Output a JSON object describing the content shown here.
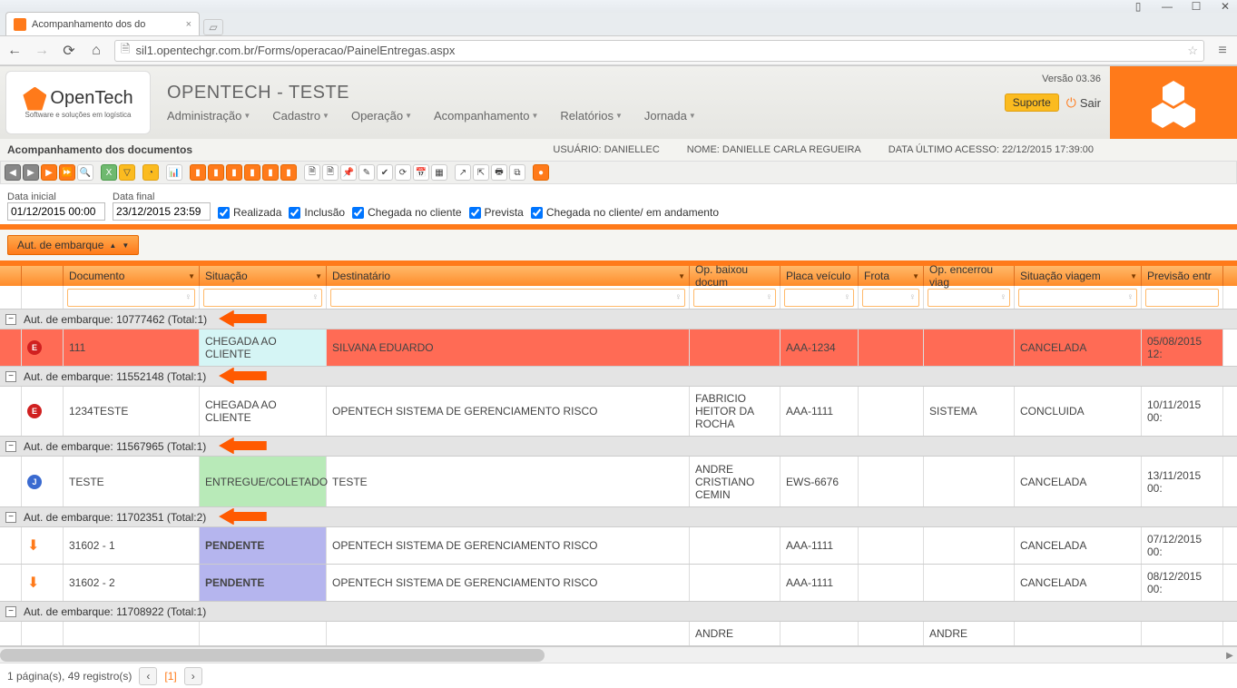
{
  "browser": {
    "tab_title": "Acompanhamento dos do",
    "url": "sil1.opentechgr.com.br/Forms/operacao/PainelEntregas.aspx"
  },
  "header": {
    "logo_text": "OpenTech",
    "logo_sub": "Software e soluções em logística",
    "brand_title": "OPENTECH - TESTE",
    "menu": [
      "Administração",
      "Cadastro",
      "Operação",
      "Acompanhamento",
      "Relatórios",
      "Jornada"
    ],
    "version": "Versão 03.36",
    "btn_suporte": "Suporte",
    "btn_sair": "Sair"
  },
  "page": {
    "title": "Acompanhamento dos documentos",
    "user_label": "USUÁRIO:",
    "user": "DANIELLEC",
    "name_label": "NOME:",
    "name": "DANIELLE CARLA REGUEIRA",
    "last_access_label": "DATA ÚLTIMO ACESSO:",
    "last_access": "22/12/2015 17:39:00"
  },
  "filters": {
    "date_start_label": "Data inicial",
    "date_start": "01/12/2015 00:00",
    "date_end_label": "Data final",
    "date_end": "23/12/2015 23:59",
    "chk1": "Realizada",
    "chk2": "Inclusão",
    "chk3": "Chegada no cliente",
    "chk4": "Prevista",
    "chk5": "Chegada no cliente/ em andamento"
  },
  "sort_button": "Aut. de embarque",
  "columns": {
    "documento": "Documento",
    "situacao": "Situação",
    "destinatario": "Destinatário",
    "op_baixou": "Op. baixou docum",
    "placa": "Placa veículo",
    "frota": "Frota",
    "op_encerrou": "Op. encerrou viag",
    "sit_viagem": "Situação viagem",
    "previsao": "Previsão entr"
  },
  "groups": [
    {
      "label": "Aut. de embarque: 10777462 (Total:1)",
      "rows": [
        {
          "ico": "E",
          "cls": "red",
          "doc": "111",
          "situ": "CHEGADA AO CLIENTE",
          "situ_cls": "situ",
          "dest": "SILVANA EDUARDO",
          "op_b": "",
          "placa": "AAA-1234",
          "frota": "",
          "op_e": "",
          "viag": "CANCELADA",
          "prev": "05/08/2015 12:"
        }
      ]
    },
    {
      "label": "Aut. de embarque: 11552148 (Total:1)",
      "rows": [
        {
          "ico": "E",
          "cls": "",
          "doc": "1234TESTE",
          "situ": "CHEGADA AO CLIENTE",
          "situ_cls": "situ",
          "dest": "OPENTECH SISTEMA DE GERENCIAMENTO RISCO",
          "op_b": "FABRICIO HEITOR DA ROCHA",
          "placa": "AAA-1111",
          "frota": "",
          "op_e": "SISTEMA",
          "viag": "CONCLUIDA",
          "prev": "10/11/2015 00:"
        }
      ]
    },
    {
      "label": "Aut. de embarque: 11567965 (Total:1)",
      "rows": [
        {
          "ico": "J",
          "cls": "tall",
          "doc": "TESTE",
          "situ": "ENTREGUE/COLETADO",
          "situ_cls": "situ-green",
          "dest": "TESTE",
          "op_b": "ANDRE CRISTIANO CEMIN",
          "placa": "EWS-6676",
          "frota": "",
          "op_e": "",
          "viag": "CANCELADA",
          "prev": "13/11/2015 00:"
        }
      ]
    },
    {
      "label": "Aut. de embarque: 11702351 (Total:2)",
      "rows": [
        {
          "ico": "AR",
          "cls": "",
          "doc": "31602 - 1",
          "situ": "PENDENTE",
          "situ_cls": "situ-purple",
          "dest": "OPENTECH SISTEMA DE GERENCIAMENTO RISCO",
          "op_b": "",
          "placa": "AAA-1111",
          "frota": "",
          "op_e": "",
          "viag": "CANCELADA",
          "prev": "07/12/2015 00:"
        },
        {
          "ico": "AR",
          "cls": "",
          "doc": "31602 - 2",
          "situ": "PENDENTE",
          "situ_cls": "situ-purple",
          "dest": "OPENTECH SISTEMA DE GERENCIAMENTO RISCO",
          "op_b": "",
          "placa": "AAA-1111",
          "frota": "",
          "op_e": "",
          "viag": "CANCELADA",
          "prev": "08/12/2015 00:"
        }
      ]
    },
    {
      "label": "Aut. de embarque: 11708922 (Total:1)",
      "rows": []
    }
  ],
  "partial_row": {
    "op_b": "ANDRE",
    "op_e": "ANDRE"
  },
  "pager": {
    "summary": "1 página(s), 49 registro(s)",
    "current": "[1]"
  }
}
